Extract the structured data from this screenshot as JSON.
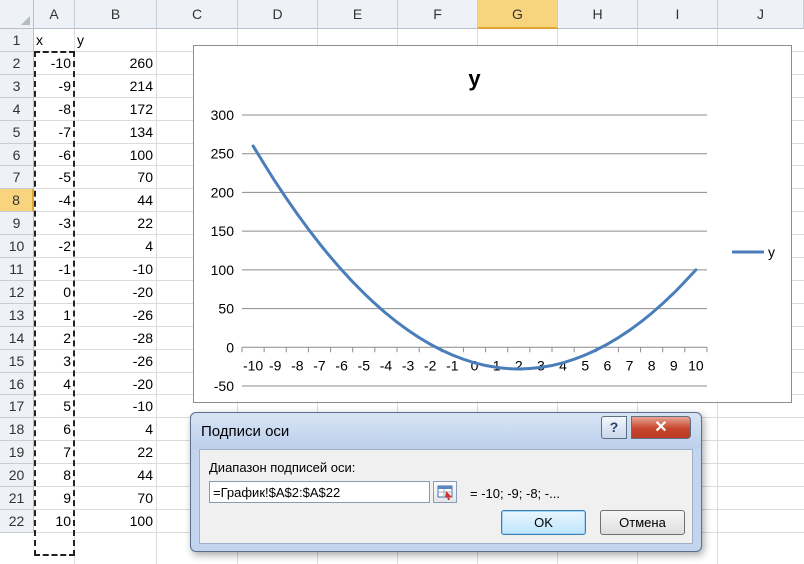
{
  "sheet": {
    "columns": [
      "A",
      "B",
      "C",
      "D",
      "E",
      "F",
      "G",
      "H",
      "I",
      "J"
    ],
    "selected_column": "G",
    "selected_row": 8,
    "rows": [
      {
        "n": 1,
        "a": "x",
        "b": "y"
      },
      {
        "n": 2,
        "a": "-10",
        "b": "260"
      },
      {
        "n": 3,
        "a": "-9",
        "b": "214"
      },
      {
        "n": 4,
        "a": "-8",
        "b": "172"
      },
      {
        "n": 5,
        "a": "-7",
        "b": "134"
      },
      {
        "n": 6,
        "a": "-6",
        "b": "100"
      },
      {
        "n": 7,
        "a": "-5",
        "b": "70"
      },
      {
        "n": 8,
        "a": "-4",
        "b": "44"
      },
      {
        "n": 9,
        "a": "-3",
        "b": "22"
      },
      {
        "n": 10,
        "a": "-2",
        "b": "4"
      },
      {
        "n": 11,
        "a": "-1",
        "b": "-10"
      },
      {
        "n": 12,
        "a": "0",
        "b": "-20"
      },
      {
        "n": 13,
        "a": "1",
        "b": "-26"
      },
      {
        "n": 14,
        "a": "2",
        "b": "-28"
      },
      {
        "n": 15,
        "a": "3",
        "b": "-26"
      },
      {
        "n": 16,
        "a": "4",
        "b": "-20"
      },
      {
        "n": 17,
        "a": "5",
        "b": "-10"
      },
      {
        "n": 18,
        "a": "6",
        "b": "4"
      },
      {
        "n": 19,
        "a": "7",
        "b": "22"
      },
      {
        "n": 20,
        "a": "8",
        "b": "44"
      },
      {
        "n": 21,
        "a": "9",
        "b": "70"
      },
      {
        "n": 22,
        "a": "10",
        "b": "100"
      }
    ]
  },
  "chart_data": {
    "type": "line",
    "title": "y",
    "categories": [
      "-10",
      "-9",
      "-8",
      "-7",
      "-6",
      "-5",
      "-4",
      "-3",
      "-2",
      "-1",
      "0",
      "1",
      "2",
      "3",
      "4",
      "5",
      "6",
      "7",
      "8",
      "9",
      "10"
    ],
    "series": [
      {
        "name": "y",
        "values": [
          260,
          214,
          172,
          134,
          100,
          70,
          44,
          22,
          4,
          -10,
          -20,
          -26,
          -28,
          -26,
          -20,
          -10,
          4,
          22,
          44,
          70,
          100
        ]
      }
    ],
    "y_ticks": [
      "300",
      "250",
      "200",
      "150",
      "100",
      "50",
      "0",
      "-50"
    ],
    "ylim": [
      -50,
      300
    ],
    "grid": true,
    "legend": "right",
    "series_color": "#4a7ebb"
  },
  "dialog": {
    "title": "Подписи оси",
    "help_label": "?",
    "close_label": "✕",
    "range_label": "Диапазон подписей оси:",
    "range_value": "=График!$A$2:$A$22",
    "preview": "= -10; -9; -8; -...",
    "ok_label": "OK",
    "cancel_label": "Отмена"
  }
}
